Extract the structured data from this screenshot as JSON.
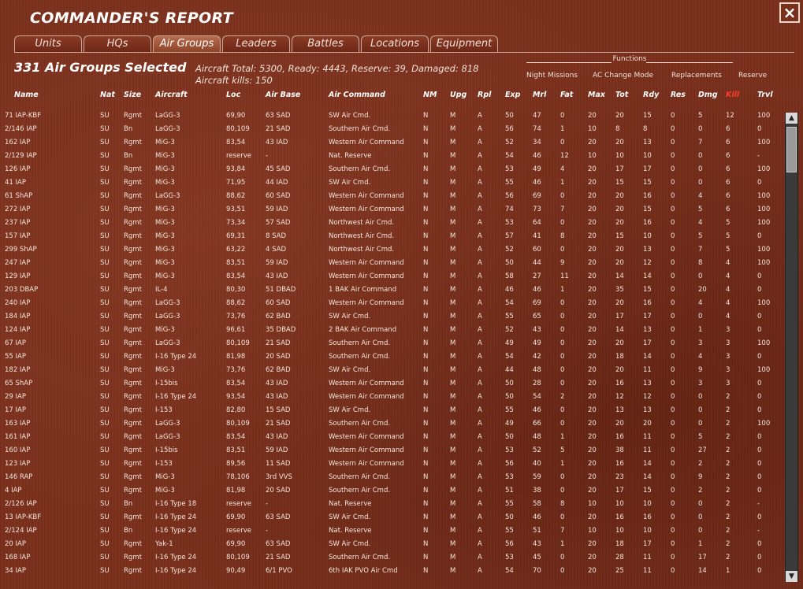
{
  "window": {
    "title": "COMMANDER'S REPORT",
    "close_label": "×"
  },
  "tabs": [
    {
      "label": "Units"
    },
    {
      "label": "HQs"
    },
    {
      "label": "Air Groups"
    },
    {
      "label": "Leaders"
    },
    {
      "label": "Battles"
    },
    {
      "label": "Locations"
    },
    {
      "label": "Equipment"
    }
  ],
  "active_tab": "Air Groups",
  "summary": {
    "selected": "331 Air Groups Selected",
    "totals": "Aircraft Total: 5300, Ready: 4443, Reserve: 39, Damaged: 818",
    "kills": "Aircraft kills: 150"
  },
  "functions": {
    "title": "Functions",
    "items": [
      {
        "label": "Night Missions"
      },
      {
        "label": "AC Change Mode"
      },
      {
        "label": "Replacements"
      },
      {
        "label": "Reserve"
      }
    ]
  },
  "columns": [
    "Name",
    "Nat",
    "Size",
    "Aircraft",
    "Loc",
    "Air Base",
    "Air Command",
    "NM",
    "Upg",
    "Rpl",
    "Exp",
    "Mrl",
    "Fat",
    "Max",
    "Tot",
    "Rdy",
    "Res",
    "Dmg",
    "Kill",
    "Trvl"
  ],
  "kill_color": "#ff3b2a",
  "rows": [
    [
      "71 IAP-KBF",
      "SU",
      "Rgmt",
      "LaGG-3",
      "69,90",
      "63 SAD",
      "SW Air Cmd.",
      "N",
      "M",
      "A",
      "50",
      "47",
      "0",
      "20",
      "20",
      "15",
      "0",
      "5",
      "12",
      "100"
    ],
    [
      "2/146 IAP",
      "SU",
      "Bn",
      "LaGG-3",
      "80,109",
      "21 SAD",
      "Southern Air Cmd.",
      "N",
      "M",
      "A",
      "56",
      "74",
      "1",
      "10",
      "8",
      "8",
      "0",
      "0",
      "6",
      "0"
    ],
    [
      "162 IAP",
      "SU",
      "Rgmt",
      "MiG-3",
      "83,54",
      "43 IAD",
      "Western Air Command",
      "N",
      "M",
      "A",
      "52",
      "34",
      "0",
      "20",
      "20",
      "13",
      "0",
      "7",
      "6",
      "100"
    ],
    [
      "2/129 IAP",
      "SU",
      "Bn",
      "MiG-3",
      "reserve",
      "-",
      "Nat. Reserve",
      "N",
      "M",
      "A",
      "54",
      "46",
      "12",
      "10",
      "10",
      "10",
      "0",
      "0",
      "6",
      "-"
    ],
    [
      "126 IAP",
      "SU",
      "Rgmt",
      "MiG-3",
      "93,84",
      "45 SAD",
      "Southern Air Cmd.",
      "N",
      "M",
      "A",
      "53",
      "49",
      "4",
      "20",
      "17",
      "17",
      "0",
      "0",
      "6",
      "100"
    ],
    [
      "41 IAP",
      "SU",
      "Rgmt",
      "MiG-3",
      "71,95",
      "44 IAD",
      "SW Air Cmd.",
      "N",
      "M",
      "A",
      "55",
      "46",
      "1",
      "20",
      "15",
      "15",
      "0",
      "0",
      "6",
      "0"
    ],
    [
      "61 ShAP",
      "SU",
      "Rgmt",
      "LaGG-3",
      "88,62",
      "60 SAD",
      "Western Air Command",
      "N",
      "M",
      "A",
      "56",
      "69",
      "0",
      "20",
      "20",
      "16",
      "0",
      "4",
      "6",
      "100"
    ],
    [
      "272 IAP",
      "SU",
      "Rgmt",
      "MiG-3",
      "93,51",
      "59 IAD",
      "Western Air Command",
      "N",
      "M",
      "A",
      "74",
      "73",
      "7",
      "20",
      "20",
      "15",
      "0",
      "5",
      "6",
      "100"
    ],
    [
      "237 IAP",
      "SU",
      "Rgmt",
      "MiG-3",
      "73,34",
      "57 SAD",
      "Northwest Air Cmd.",
      "N",
      "M",
      "A",
      "53",
      "64",
      "0",
      "20",
      "20",
      "16",
      "0",
      "4",
      "5",
      "100"
    ],
    [
      "157 IAP",
      "SU",
      "Rgmt",
      "MiG-3",
      "69,31",
      "8 SAD",
      "Northwest Air Cmd.",
      "N",
      "M",
      "A",
      "57",
      "41",
      "8",
      "20",
      "15",
      "10",
      "0",
      "5",
      "5",
      "0"
    ],
    [
      "299 ShAP",
      "SU",
      "Rgmt",
      "MiG-3",
      "63,22",
      "4 SAD",
      "Northwest Air Cmd.",
      "N",
      "M",
      "A",
      "52",
      "60",
      "0",
      "20",
      "20",
      "13",
      "0",
      "7",
      "5",
      "100"
    ],
    [
      "247 IAP",
      "SU",
      "Rgmt",
      "MiG-3",
      "83,51",
      "59 IAD",
      "Western Air Command",
      "N",
      "M",
      "A",
      "50",
      "44",
      "9",
      "20",
      "20",
      "12",
      "0",
      "8",
      "4",
      "100"
    ],
    [
      "129 IAP",
      "SU",
      "Rgmt",
      "MiG-3",
      "83,54",
      "43 IAD",
      "Western Air Command",
      "N",
      "M",
      "A",
      "58",
      "27",
      "11",
      "20",
      "14",
      "14",
      "0",
      "0",
      "4",
      "0"
    ],
    [
      "203 DBAP",
      "SU",
      "Rgmt",
      "IL-4",
      "80,30",
      "51 DBAD",
      "1 BAK Air Command",
      "N",
      "M",
      "A",
      "46",
      "46",
      "1",
      "20",
      "35",
      "15",
      "0",
      "20",
      "4",
      "0"
    ],
    [
      "240 IAP",
      "SU",
      "Rgmt",
      "LaGG-3",
      "88,62",
      "60 SAD",
      "Western Air Command",
      "N",
      "M",
      "A",
      "54",
      "69",
      "0",
      "20",
      "20",
      "16",
      "0",
      "4",
      "4",
      "100"
    ],
    [
      "184 IAP",
      "SU",
      "Rgmt",
      "LaGG-3",
      "73,76",
      "62 BAD",
      "SW Air Cmd.",
      "N",
      "M",
      "A",
      "55",
      "65",
      "0",
      "20",
      "17",
      "17",
      "0",
      "0",
      "4",
      "0"
    ],
    [
      "124 IAP",
      "SU",
      "Rgmt",
      "MiG-3",
      "96,61",
      "35 DBAD",
      "2 BAK Air Command",
      "N",
      "M",
      "A",
      "52",
      "43",
      "0",
      "20",
      "14",
      "13",
      "0",
      "1",
      "3",
      "0"
    ],
    [
      "67 IAP",
      "SU",
      "Rgmt",
      "LaGG-3",
      "80,109",
      "21 SAD",
      "Southern Air Cmd.",
      "N",
      "M",
      "A",
      "49",
      "49",
      "0",
      "20",
      "20",
      "17",
      "0",
      "3",
      "3",
      "100"
    ],
    [
      "55 IAP",
      "SU",
      "Rgmt",
      "I-16 Type 24",
      "81,98",
      "20 SAD",
      "Southern Air Cmd.",
      "N",
      "M",
      "A",
      "54",
      "42",
      "0",
      "20",
      "18",
      "14",
      "0",
      "4",
      "3",
      "0"
    ],
    [
      "182 IAP",
      "SU",
      "Rgmt",
      "MiG-3",
      "73,76",
      "62 BAD",
      "SW Air Cmd.",
      "N",
      "M",
      "A",
      "44",
      "48",
      "0",
      "20",
      "20",
      "11",
      "0",
      "9",
      "3",
      "100"
    ],
    [
      "65 ShAP",
      "SU",
      "Rgmt",
      "I-15bis",
      "83,54",
      "43 IAD",
      "Western Air Command",
      "N",
      "M",
      "A",
      "50",
      "28",
      "0",
      "20",
      "16",
      "13",
      "0",
      "3",
      "3",
      "0"
    ],
    [
      "29 IAP",
      "SU",
      "Rgmt",
      "I-16 Type 24",
      "93,54",
      "43 IAD",
      "Western Air Command",
      "N",
      "M",
      "A",
      "50",
      "54",
      "2",
      "20",
      "12",
      "12",
      "0",
      "0",
      "2",
      "0"
    ],
    [
      "17 IAP",
      "SU",
      "Rgmt",
      "I-153",
      "82,80",
      "15 SAD",
      "SW Air Cmd.",
      "N",
      "M",
      "A",
      "55",
      "46",
      "0",
      "20",
      "13",
      "13",
      "0",
      "0",
      "2",
      "0"
    ],
    [
      "163 IAP",
      "SU",
      "Rgmt",
      "LaGG-3",
      "80,109",
      "21 SAD",
      "Southern Air Cmd.",
      "N",
      "M",
      "A",
      "49",
      "66",
      "0",
      "20",
      "20",
      "20",
      "0",
      "0",
      "2",
      "100"
    ],
    [
      "161 IAP",
      "SU",
      "Rgmt",
      "LaGG-3",
      "83,54",
      "43 IAD",
      "Western Air Command",
      "N",
      "M",
      "A",
      "50",
      "48",
      "1",
      "20",
      "16",
      "11",
      "0",
      "5",
      "2",
      "0"
    ],
    [
      "160 IAP",
      "SU",
      "Rgmt",
      "I-15bis",
      "83,51",
      "59 IAD",
      "Western Air Command",
      "N",
      "M",
      "A",
      "53",
      "52",
      "5",
      "20",
      "38",
      "11",
      "0",
      "27",
      "2",
      "0"
    ],
    [
      "123 IAP",
      "SU",
      "Rgmt",
      "I-153",
      "89,56",
      "11 SAD",
      "Western Air Command",
      "N",
      "M",
      "A",
      "56",
      "40",
      "1",
      "20",
      "16",
      "14",
      "0",
      "2",
      "2",
      "0"
    ],
    [
      "146 RAP",
      "SU",
      "Rgmt",
      "MiG-3",
      "78,106",
      "3rd VVS",
      "Southern Air Cmd.",
      "N",
      "M",
      "A",
      "53",
      "59",
      "0",
      "20",
      "23",
      "14",
      "0",
      "9",
      "2",
      "0"
    ],
    [
      "4 IAP",
      "SU",
      "Rgmt",
      "MiG-3",
      "81,98",
      "20 SAD",
      "Southern Air Cmd.",
      "N",
      "M",
      "A",
      "51",
      "38",
      "0",
      "20",
      "17",
      "15",
      "0",
      "2",
      "2",
      "0"
    ],
    [
      "2/126 IAP",
      "SU",
      "Bn",
      "I-16 Type 18",
      "reserve",
      "-",
      "Nat. Reserve",
      "N",
      "M",
      "A",
      "55",
      "58",
      "8",
      "10",
      "10",
      "10",
      "0",
      "0",
      "2",
      "-"
    ],
    [
      "13 IAP-KBF",
      "SU",
      "Rgmt",
      "I-16 Type 24",
      "69,90",
      "63 SAD",
      "SW Air Cmd.",
      "N",
      "M",
      "A",
      "50",
      "46",
      "0",
      "20",
      "16",
      "16",
      "0",
      "0",
      "2",
      "0"
    ],
    [
      "2/124 IAP",
      "SU",
      "Bn",
      "I-16 Type 24",
      "reserve",
      "-",
      "Nat. Reserve",
      "N",
      "M",
      "A",
      "55",
      "51",
      "7",
      "10",
      "10",
      "10",
      "0",
      "0",
      "2",
      "-"
    ],
    [
      "20 IAP",
      "SU",
      "Rgmt",
      "Yak-1",
      "69,90",
      "63 SAD",
      "SW Air Cmd.",
      "N",
      "M",
      "A",
      "56",
      "43",
      "1",
      "20",
      "18",
      "17",
      "0",
      "1",
      "2",
      "0"
    ],
    [
      "168 IAP",
      "SU",
      "Rgmt",
      "I-16 Type 24",
      "80,109",
      "21 SAD",
      "Southern Air Cmd.",
      "N",
      "M",
      "A",
      "53",
      "45",
      "0",
      "20",
      "28",
      "11",
      "0",
      "17",
      "2",
      "0"
    ],
    [
      "34 IAP",
      "SU",
      "Rgmt",
      "I-16 Type 24",
      "90,49",
      "6/1 PVO",
      "6th IAK PVO Air Cmd",
      "N",
      "M",
      "A",
      "54",
      "70",
      "0",
      "20",
      "25",
      "11",
      "0",
      "14",
      "1",
      "0"
    ]
  ],
  "scrollbar": {
    "up_label": "▲",
    "down_label": "▼"
  }
}
